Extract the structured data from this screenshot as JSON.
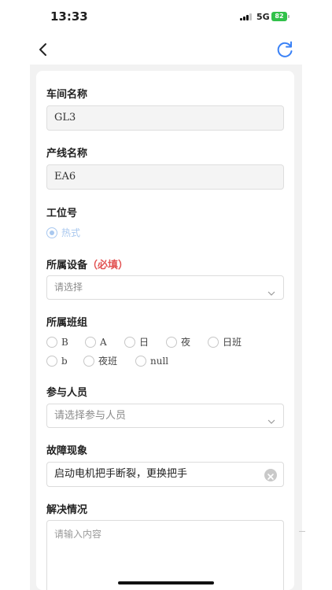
{
  "status_bar": {
    "time": "13:33",
    "network": "5G",
    "battery": "82"
  },
  "icons": {
    "back": "chevron-left-icon",
    "refresh": "refresh-icon",
    "dropdown": "chevron-down-icon",
    "clear": "clear-circle-icon"
  },
  "colors": {
    "accent": "#3b82f6",
    "required": "#e25252",
    "radio_checked": "#a9c8ef",
    "battery": "#31c14a"
  },
  "form": {
    "workshop": {
      "label": "车间名称",
      "value": "GL3"
    },
    "line": {
      "label": "产线名称",
      "value": "EA6"
    },
    "station": {
      "label": "工位号",
      "options": [
        {
          "label": "热式",
          "checked": true
        }
      ]
    },
    "equipment": {
      "label": "所属设备",
      "required_tag": "（必填）",
      "placeholder": "请选择"
    },
    "shift_group": {
      "label": "所属班组",
      "options": [
        {
          "label": "B",
          "checked": false
        },
        {
          "label": "A",
          "checked": false
        },
        {
          "label": "日",
          "checked": false
        },
        {
          "label": "夜",
          "checked": false
        },
        {
          "label": "日班",
          "checked": false
        },
        {
          "label": "b",
          "checked": false
        },
        {
          "label": "夜班",
          "checked": false
        },
        {
          "label": "null",
          "checked": false
        }
      ]
    },
    "participants": {
      "label": "参与人员",
      "placeholder": "请选择参与人员"
    },
    "fault": {
      "label": "故障现象",
      "value": "启动电机把手断裂，更换把手"
    },
    "resolution": {
      "label": "解决情况",
      "placeholder": "请输入内容"
    }
  }
}
